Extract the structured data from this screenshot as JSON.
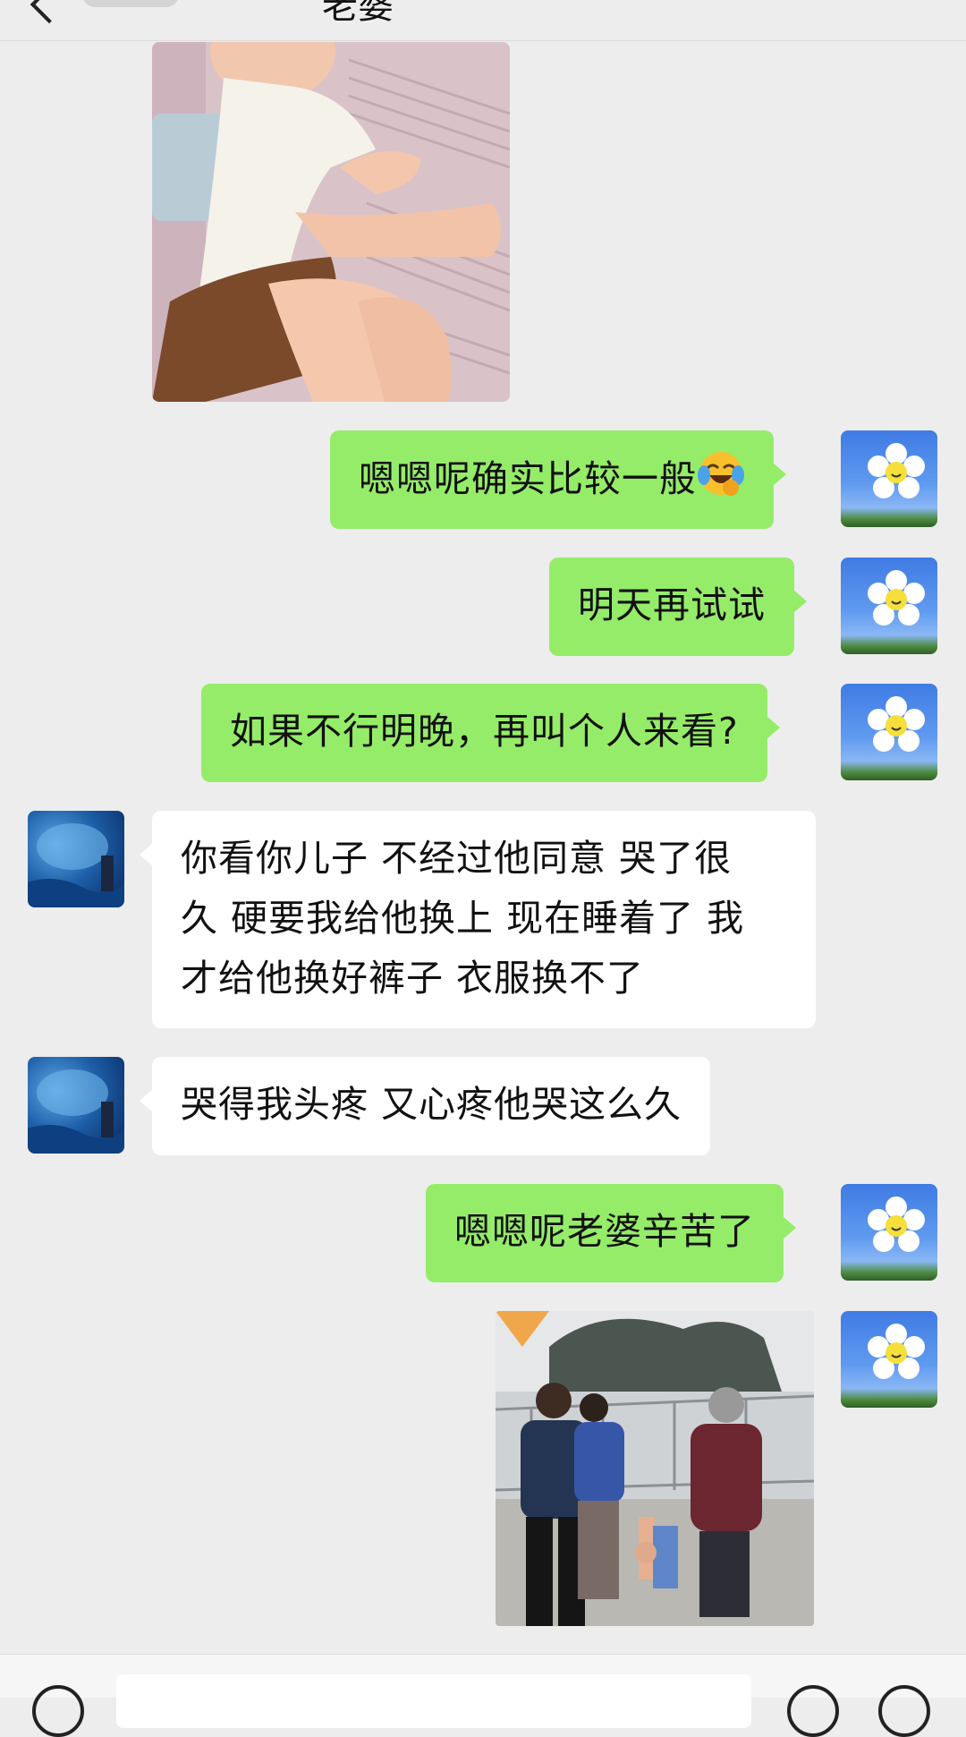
{
  "header": {
    "back_icon": "chevron-left-icon",
    "title": "老婆"
  },
  "messages": [
    {
      "from": "other",
      "type": "image",
      "description_icon": "sleeping-child-photo"
    },
    {
      "from": "me",
      "type": "text",
      "text": "嗯嗯呢确实比较一般",
      "emoji": "laugh-cry-emoji"
    },
    {
      "from": "me",
      "type": "text",
      "text": "明天再试试"
    },
    {
      "from": "me",
      "type": "text",
      "text": "如果不行明晚，再叫个人来看?"
    },
    {
      "from": "other",
      "type": "text",
      "lines": [
        "你看你儿子 不经过他同意 哭了很",
        "久 硬要我给他换上 现在睡着了 我",
        "才给他换好裤子 衣服换不了"
      ]
    },
    {
      "from": "other",
      "type": "text",
      "text": "哭得我头疼 又心疼他哭这么久"
    },
    {
      "from": "me",
      "type": "text",
      "text": "嗯嗯呢老婆辛苦了"
    },
    {
      "from": "me",
      "type": "image",
      "description_icon": "family-walking-photo"
    }
  ],
  "footer": {
    "voice_icon": "voice-icon",
    "emoji_icon": "emoji-icon",
    "plus_icon": "plus-icon"
  },
  "colors": {
    "me_bubble": "#95ec69",
    "other_bubble": "#ffffff",
    "background": "#ededed"
  }
}
